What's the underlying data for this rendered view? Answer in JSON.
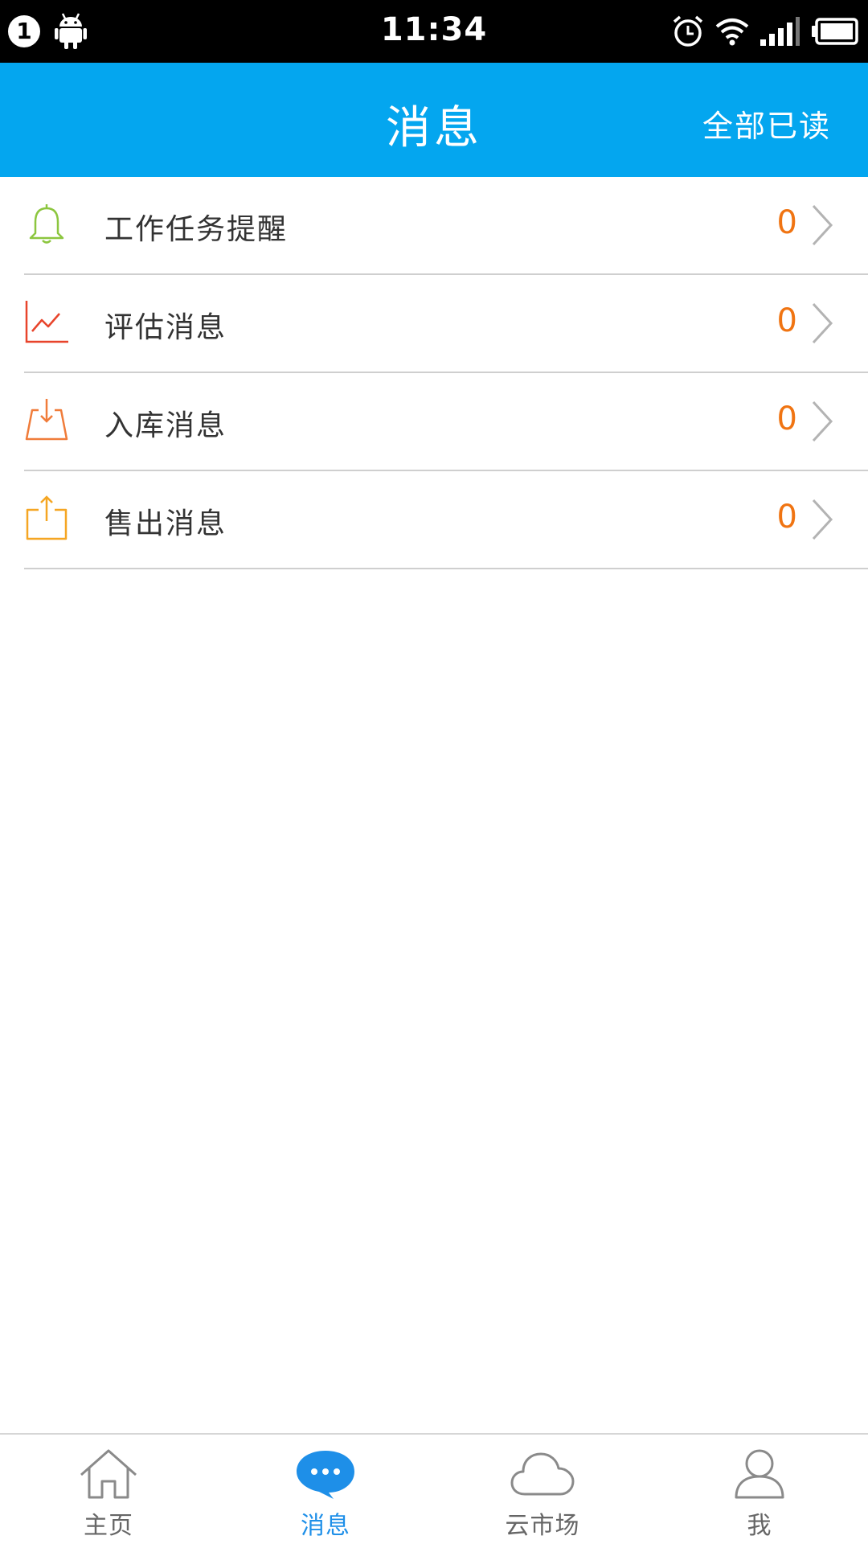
{
  "status_bar": {
    "notification_count": "1",
    "time": "11:34",
    "icons": [
      "android-icon",
      "alarm-icon",
      "wifi-icon",
      "signal-icon",
      "battery-icon"
    ]
  },
  "header": {
    "title": "消息",
    "action_label": "全部已读"
  },
  "messages": [
    {
      "label": "工作任务提醒",
      "count": "0",
      "icon": "bell-icon",
      "color": "#8cc63f"
    },
    {
      "label": "评估消息",
      "count": "0",
      "icon": "trend-chart-icon",
      "color": "#e8442b"
    },
    {
      "label": "入库消息",
      "count": "0",
      "icon": "download-tray-icon",
      "color": "#f07c3a"
    },
    {
      "label": "售出消息",
      "count": "0",
      "icon": "upload-tray-icon",
      "color": "#f5a623"
    }
  ],
  "tabs": [
    {
      "label": "主页",
      "icon": "home-icon",
      "active": false
    },
    {
      "label": "消息",
      "icon": "chat-bubble-icon",
      "active": true
    },
    {
      "label": "云市场",
      "icon": "cloud-icon",
      "active": false
    },
    {
      "label": "我",
      "icon": "user-icon",
      "active": false
    }
  ],
  "colors": {
    "header_bg": "#04a6ef",
    "count": "#f07412",
    "active_tab": "#1e8fe8"
  }
}
